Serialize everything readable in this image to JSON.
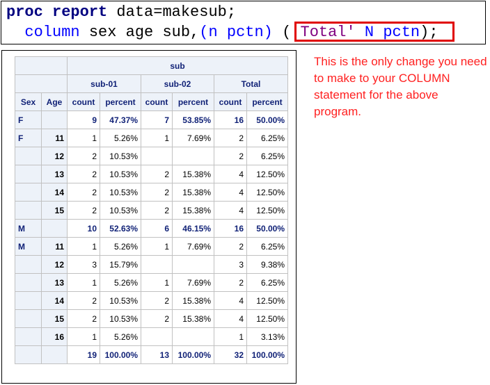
{
  "code": {
    "line1": {
      "kw": "proc report",
      "rest": " data=makesub;"
    },
    "line2": {
      "kw": "column",
      "plain": " sex age sub,",
      "paren1": "(n pctn)",
      "space": " ",
      "open": "(",
      "total": "'Total'",
      "np": " N pctn",
      "close": ")",
      "semi": ";"
    }
  },
  "note": "This is the only change you need to make to your COLUMN statement for the above program.",
  "table": {
    "spanning_header": "sub",
    "group_headers": [
      "sub-01",
      "sub-02",
      "Total"
    ],
    "column_headers": [
      "Sex",
      "Age",
      "count",
      "percent",
      "count",
      "percent",
      "count",
      "percent"
    ],
    "rows": [
      {
        "sex": "F",
        "age": "",
        "c1": "9",
        "p1": "47.37%",
        "c2": "7",
        "p2": "53.85%",
        "c3": "16",
        "p3": "50.00%",
        "summary": true
      },
      {
        "sex": "F",
        "age": "11",
        "c1": "1",
        "p1": "5.26%",
        "c2": "1",
        "p2": "7.69%",
        "c3": "2",
        "p3": "6.25%",
        "summary": false
      },
      {
        "sex": "",
        "age": "12",
        "c1": "2",
        "p1": "10.53%",
        "c2": "",
        "p2": "",
        "c3": "2",
        "p3": "6.25%",
        "summary": false
      },
      {
        "sex": "",
        "age": "13",
        "c1": "2",
        "p1": "10.53%",
        "c2": "2",
        "p2": "15.38%",
        "c3": "4",
        "p3": "12.50%",
        "summary": false
      },
      {
        "sex": "",
        "age": "14",
        "c1": "2",
        "p1": "10.53%",
        "c2": "2",
        "p2": "15.38%",
        "c3": "4",
        "p3": "12.50%",
        "summary": false
      },
      {
        "sex": "",
        "age": "15",
        "c1": "2",
        "p1": "10.53%",
        "c2": "2",
        "p2": "15.38%",
        "c3": "4",
        "p3": "12.50%",
        "summary": false
      },
      {
        "sex": "M",
        "age": "",
        "c1": "10",
        "p1": "52.63%",
        "c2": "6",
        "p2": "46.15%",
        "c3": "16",
        "p3": "50.00%",
        "summary": true
      },
      {
        "sex": "M",
        "age": "11",
        "c1": "1",
        "p1": "5.26%",
        "c2": "1",
        "p2": "7.69%",
        "c3": "2",
        "p3": "6.25%",
        "summary": false
      },
      {
        "sex": "",
        "age": "12",
        "c1": "3",
        "p1": "15.79%",
        "c2": "",
        "p2": "",
        "c3": "3",
        "p3": "9.38%",
        "summary": false
      },
      {
        "sex": "",
        "age": "13",
        "c1": "1",
        "p1": "5.26%",
        "c2": "1",
        "p2": "7.69%",
        "c3": "2",
        "p3": "6.25%",
        "summary": false
      },
      {
        "sex": "",
        "age": "14",
        "c1": "2",
        "p1": "10.53%",
        "c2": "2",
        "p2": "15.38%",
        "c3": "4",
        "p3": "12.50%",
        "summary": false
      },
      {
        "sex": "",
        "age": "15",
        "c1": "2",
        "p1": "10.53%",
        "c2": "2",
        "p2": "15.38%",
        "c3": "4",
        "p3": "12.50%",
        "summary": false
      },
      {
        "sex": "",
        "age": "16",
        "c1": "1",
        "p1": "5.26%",
        "c2": "",
        "p2": "",
        "c3": "1",
        "p3": "3.13%",
        "summary": false
      },
      {
        "sex": "",
        "age": "",
        "c1": "19",
        "p1": "100.00%",
        "c2": "13",
        "p2": "100.00%",
        "c3": "32",
        "p3": "100.00%",
        "summary": true
      }
    ]
  },
  "colors": {
    "header_bg": "#edf2f9",
    "header_text": "#112277",
    "highlight_border": "#e00000",
    "note_text": "#ff2020"
  }
}
